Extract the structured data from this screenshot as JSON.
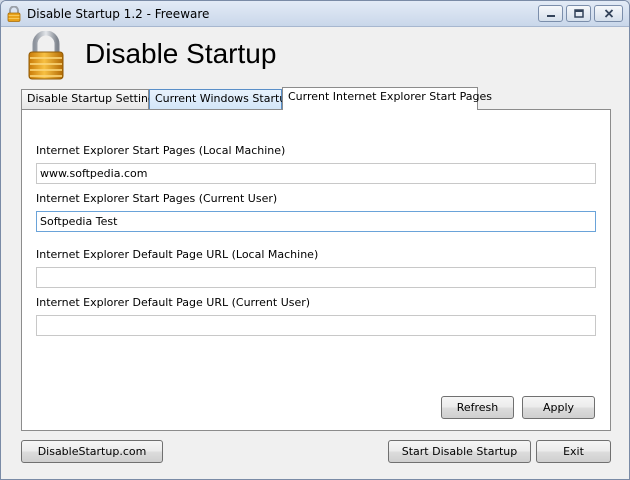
{
  "window": {
    "title": "Disable Startup 1.2 - Freeware"
  },
  "header": {
    "app_title": "Disable Startup"
  },
  "tabs": [
    {
      "label": "Disable Startup Settings",
      "active": false
    },
    {
      "label": "Current Windows Startup",
      "active": false
    },
    {
      "label": "Current Internet Explorer Start Pages",
      "active": true
    }
  ],
  "fields": [
    {
      "label": "Internet Explorer Start Pages (Local Machine)",
      "value": "www.softpedia.com"
    },
    {
      "label": "Internet Explorer Start Pages (Current User)",
      "value": "Softpedia Test"
    },
    {
      "label": "Internet Explorer Default Page URL (Local Machine)",
      "value": ""
    },
    {
      "label": "Internet Explorer Default Page URL (Current User)",
      "value": ""
    }
  ],
  "buttons": {
    "refresh": "Refresh",
    "apply": "Apply",
    "website": "DisableStartup.com",
    "start": "Start Disable Startup",
    "exit": "Exit"
  },
  "colors": {
    "lock_body": "#e8a21c",
    "lock_shackle": "#b8bcc4"
  }
}
